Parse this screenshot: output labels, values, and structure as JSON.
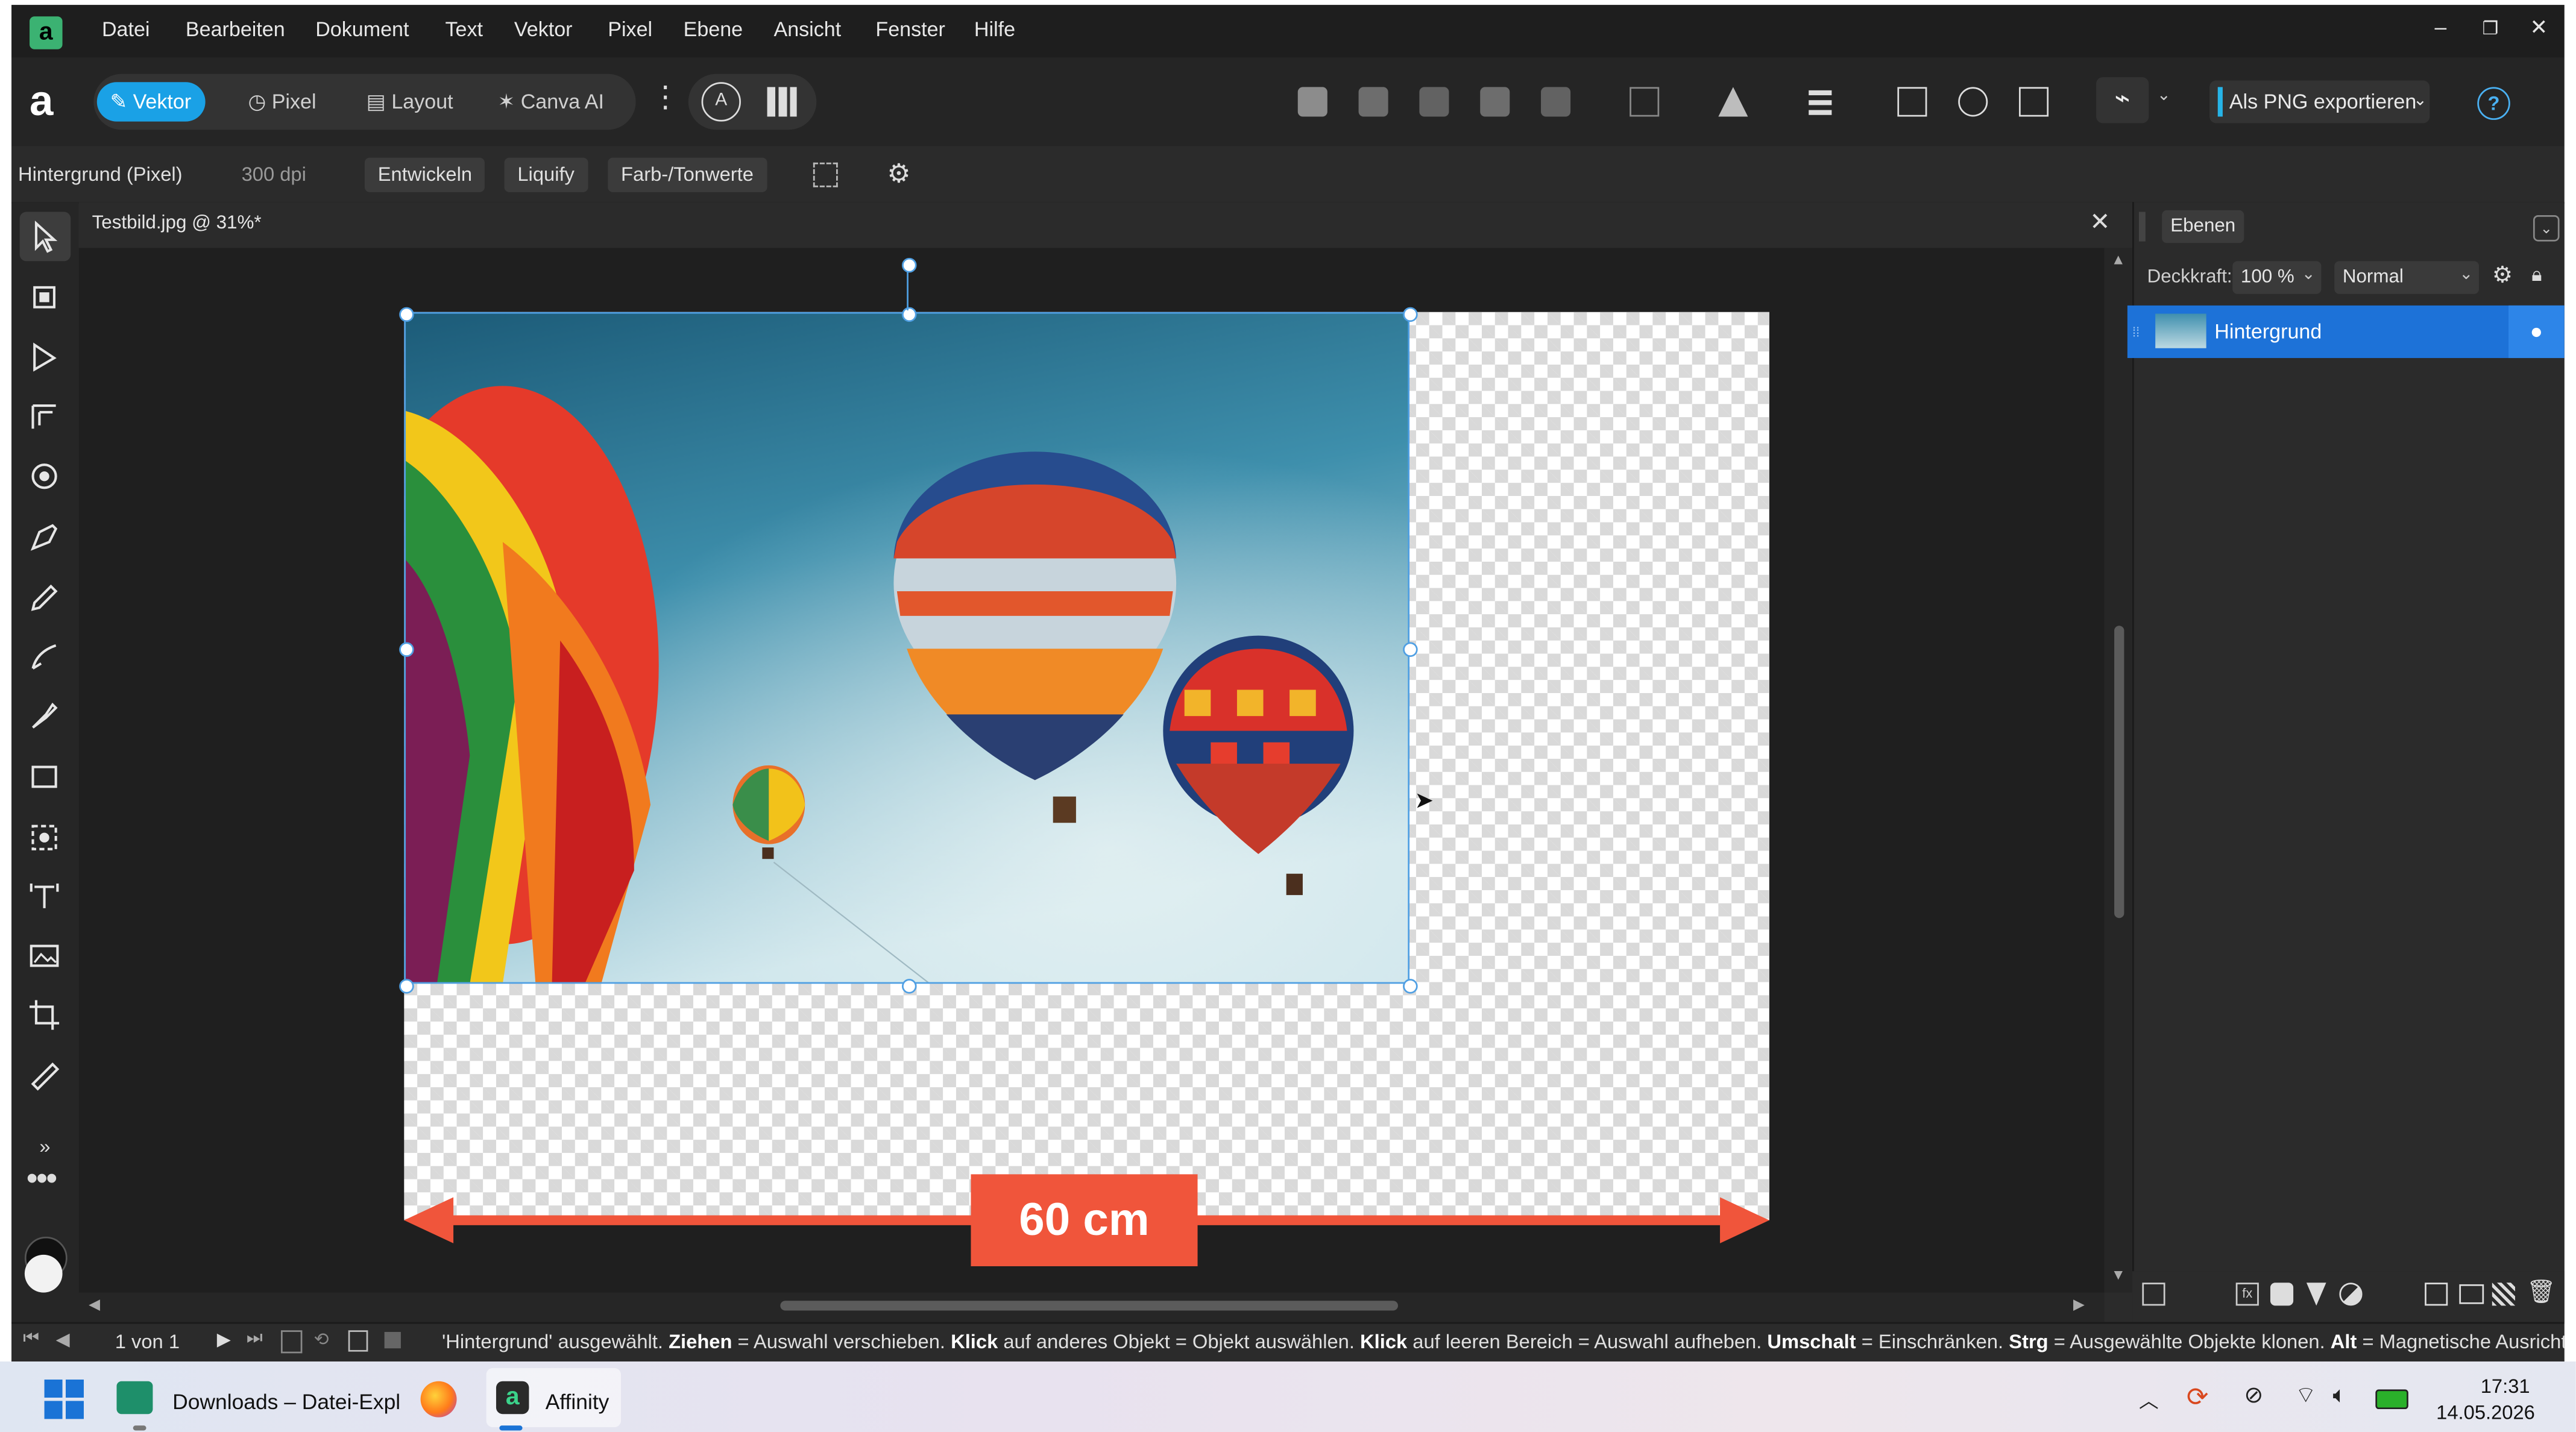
{
  "menu": {
    "logo": "a",
    "items": [
      "Datei",
      "Bearbeiten",
      "Dokument",
      "Text",
      "Vektor",
      "Pixel",
      "Ebene",
      "Ansicht",
      "Fenster",
      "Hilfe"
    ],
    "minimize": "–",
    "restore": "❐",
    "close": "✕"
  },
  "toolbar": {
    "brand": "a",
    "personas": [
      "Vektor",
      "Pixel",
      "Layout",
      "Canva AI"
    ],
    "more": "⋮",
    "export_label": "Als PNG exportieren",
    "help": "?"
  },
  "context": {
    "layer_info": "Hintergrund (Pixel)",
    "dpi": "300 dpi",
    "buttons": [
      "Entwickeln",
      "Liquify",
      "Farb-/Tonwerte"
    ]
  },
  "document": {
    "tab_title": "Testbild.jpg @ 31%*",
    "close": "✕",
    "measurement_label": "60 cm"
  },
  "layers_panel": {
    "tab": "Ebenen",
    "opacity_label": "Deckkraft:",
    "opacity_value": "100 %",
    "blend_mode": "Normal",
    "layer_name": "Hintergrund",
    "eye": "●"
  },
  "status": {
    "page": "1 von 1",
    "parts": [
      {
        "t": "'Hintergrund' ausgewählt. ",
        "b": false
      },
      {
        "t": "Ziehen",
        "b": true
      },
      {
        "t": " = Auswahl verschieben. ",
        "b": false
      },
      {
        "t": "Klick",
        "b": true
      },
      {
        "t": " auf anderes Objekt = Objekt auswählen. ",
        "b": false
      },
      {
        "t": "Klick",
        "b": true
      },
      {
        "t": " auf leeren Bereich = Auswahl aufheben. ",
        "b": false
      },
      {
        "t": "Umschalt",
        "b": true
      },
      {
        "t": " = Einschränken. ",
        "b": false
      },
      {
        "t": "Strg",
        "b": true
      },
      {
        "t": " = Ausgewählte Objekte klonen. ",
        "b": false
      },
      {
        "t": "Alt",
        "b": true
      },
      {
        "t": " = Magnetische Ausricht",
        "b": false
      }
    ]
  },
  "taskbar": {
    "explorer": "Downloads – Datei-Expl",
    "affinity": "Affinity",
    "time": "17:31",
    "date": "14.05.2026"
  },
  "colors": {
    "accent": "#1aa1e6",
    "selection": "#1d72d8",
    "measure": "#f0553b"
  }
}
